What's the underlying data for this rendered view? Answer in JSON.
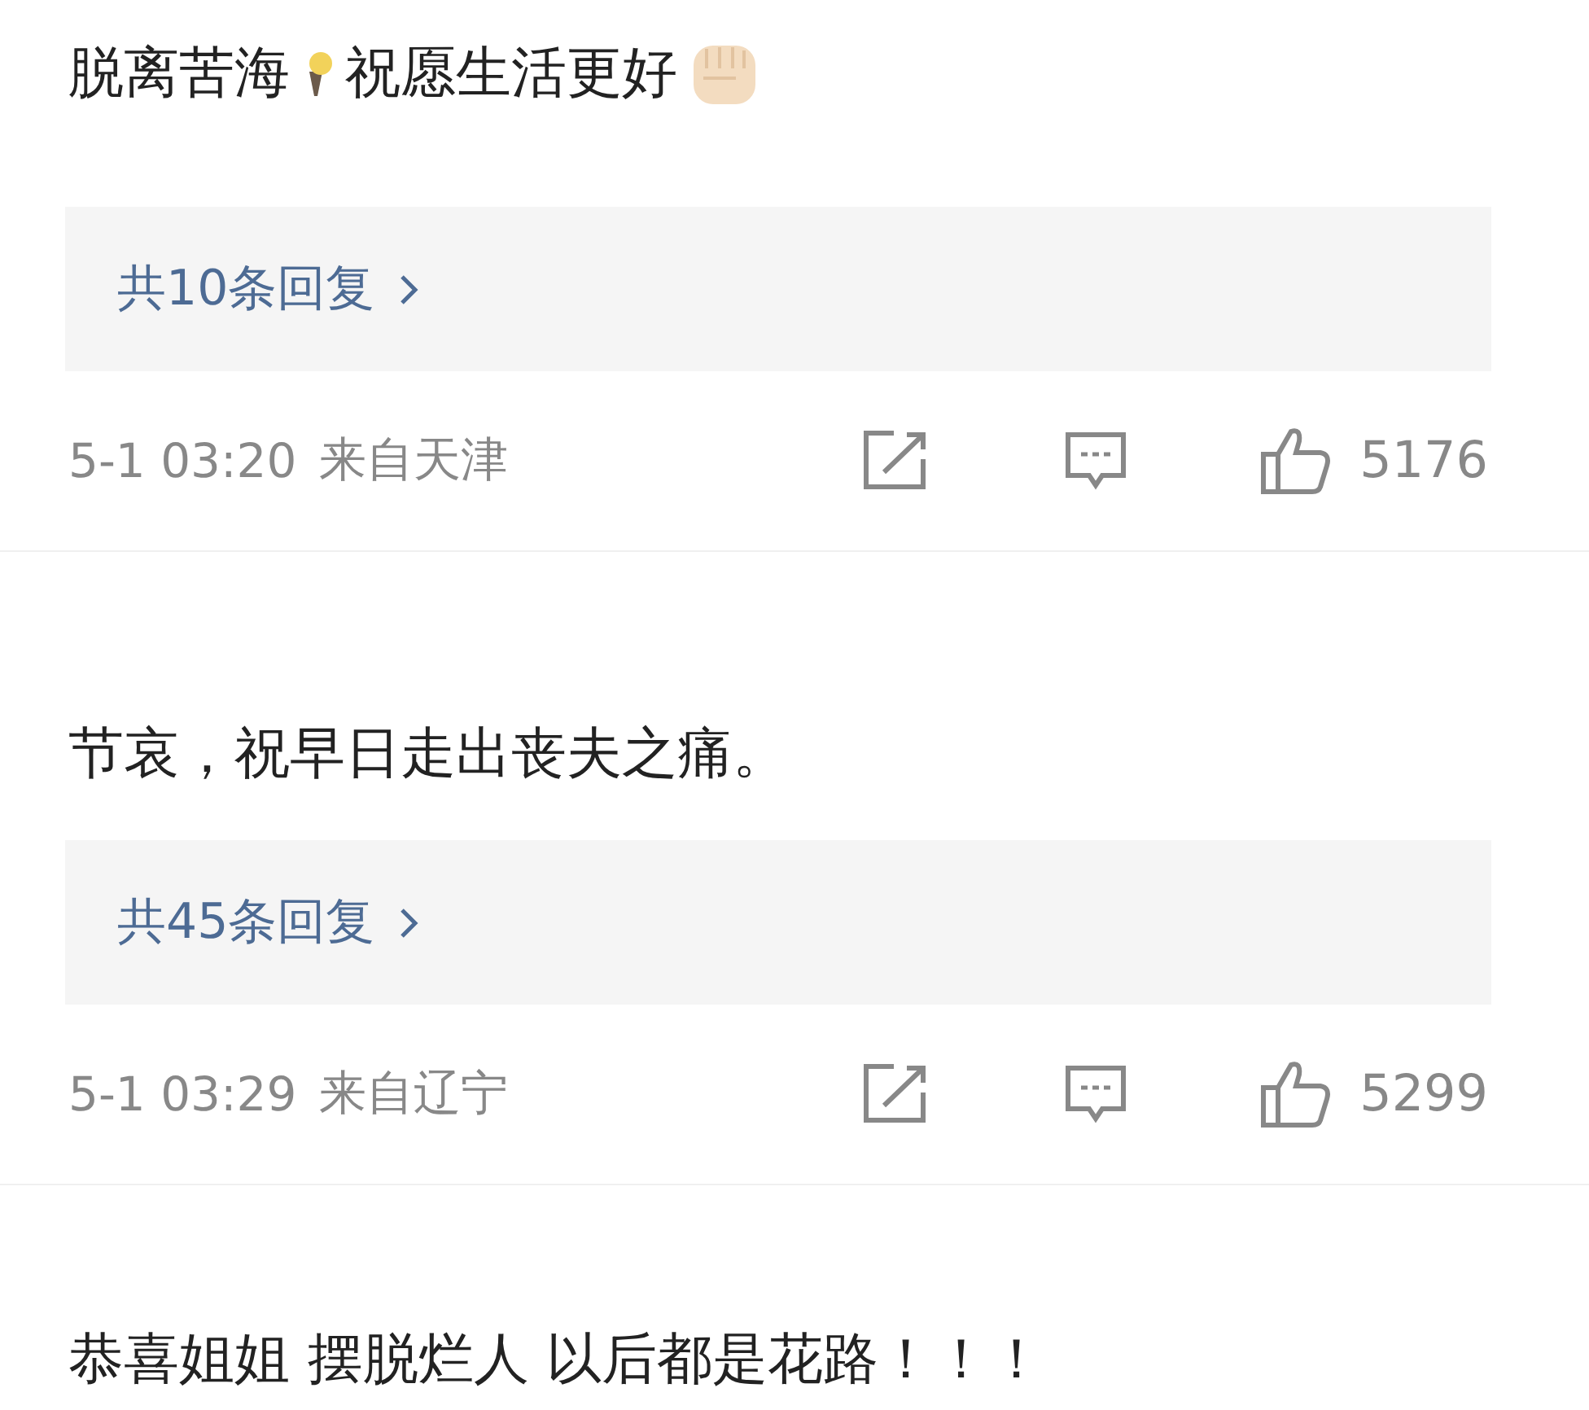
{
  "comments": [
    {
      "text_parts": [
        "脱离苦海",
        "祝愿生活更好"
      ],
      "replies": "共10条回复",
      "time": "5-1 03:20",
      "location": "来自天津",
      "likes": "5176"
    },
    {
      "text_parts": [
        "节哀，祝早日走出丧夫之痛。"
      ],
      "replies": "共45条回复",
      "time": "5-1 03:29",
      "location": "来自辽宁",
      "likes": "5299"
    },
    {
      "text_parts": [
        "恭喜姐姐 摆脱烂人 以后都是花路！！！"
      ]
    }
  ]
}
